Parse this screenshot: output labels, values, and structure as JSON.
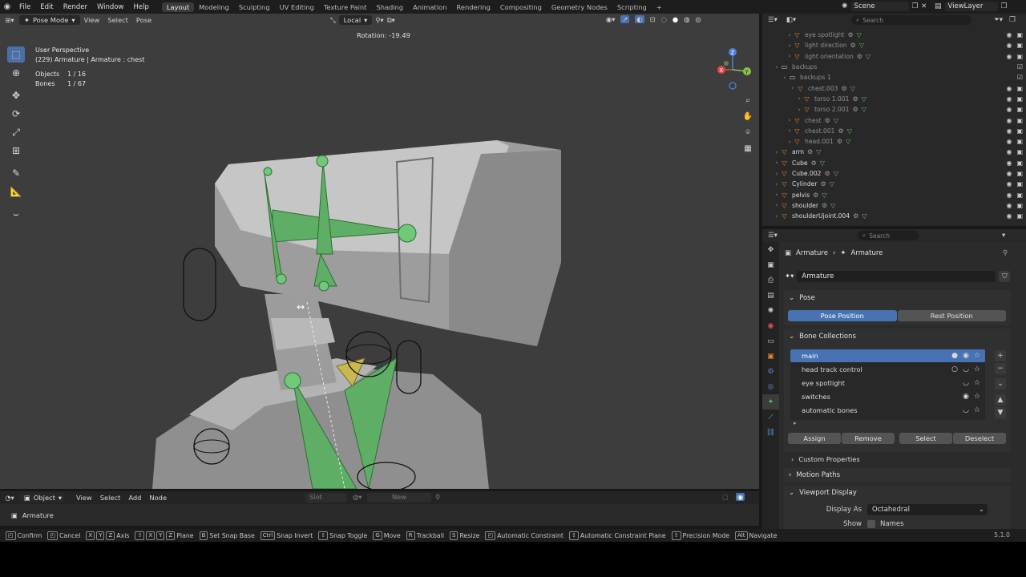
{
  "topbar": {
    "menus": [
      "File",
      "Edit",
      "Render",
      "Window",
      "Help"
    ],
    "workspaces": [
      "Layout",
      "Modeling",
      "Sculpting",
      "UV Editing",
      "Texture Paint",
      "Shading",
      "Animation",
      "Rendering",
      "Compositing",
      "Geometry Nodes",
      "Scripting"
    ],
    "active_workspace": "Layout",
    "plus_label": "+",
    "scene": "Scene",
    "view_layer": "ViewLayer"
  },
  "viewport": {
    "mode": "Pose Mode",
    "menus": [
      "View",
      "Select",
      "Pose"
    ],
    "orientation": "Local",
    "operator_readout": "Rotation: -19.49",
    "overlay": {
      "perspective": "User Perspective",
      "active": "(229) Armature | Armature : chest",
      "objects_label": "Objects",
      "objects_value": "1 / 16",
      "bones_label": "Bones",
      "bones_value": "1 / 67"
    },
    "gizmo": {
      "x": "X",
      "y": "Y",
      "z": "Z"
    }
  },
  "outliner": {
    "search_placeholder": "Search",
    "rows": [
      {
        "label": "eye spotlight",
        "dim": true
      },
      {
        "label": "light direction",
        "dim": true
      },
      {
        "label": "light orientation",
        "dim": true
      },
      {
        "label": "backups",
        "dim": true
      },
      {
        "label": "backups 1",
        "dim": true
      },
      {
        "label": "chest.003",
        "dim": true
      },
      {
        "label": "torso 1.001",
        "dim": true
      },
      {
        "label": "torso 2.001",
        "dim": true
      },
      {
        "label": "chest",
        "dim": true
      },
      {
        "label": "chest.001",
        "dim": true
      },
      {
        "label": "head.001",
        "dim": true
      },
      {
        "label": "arm",
        "dim": false
      },
      {
        "label": "Cube",
        "dim": false
      },
      {
        "label": "Cube.002",
        "dim": false
      },
      {
        "label": "Cylinder",
        "dim": false
      },
      {
        "label": "pelvis",
        "dim": false
      },
      {
        "label": "shoulder",
        "dim": false
      },
      {
        "label": "shoulderUjoint.004",
        "dim": false
      }
    ]
  },
  "properties": {
    "search_placeholder": "Search",
    "breadcrumb": [
      "Armature",
      "Armature"
    ],
    "datablock": "Armature",
    "pose": {
      "title": "Pose",
      "pose_position": "Pose Position",
      "rest_position": "Rest Position"
    },
    "bone_collections": {
      "title": "Bone Collections",
      "items": [
        "main",
        "head track control",
        "eye spotlight",
        "switches",
        "automatic bones"
      ],
      "assign": "Assign",
      "remove": "Remove",
      "select": "Select",
      "deselect": "Deselect"
    },
    "custom_properties": "Custom Properties",
    "motion_paths": "Motion Paths",
    "viewport_display": {
      "title": "Viewport Display",
      "display_as_label": "Display As",
      "display_as_value": "Octahedral",
      "show_label": "Show",
      "names_label": "Names"
    }
  },
  "bottom": {
    "editor_mode": "Object",
    "menus": [
      "View",
      "Select",
      "Add",
      "Node"
    ],
    "slot": "Slot",
    "new": "New",
    "active_object": "Armature"
  },
  "statusbar": {
    "items": [
      {
        "key": "",
        "label": "Confirm"
      },
      {
        "key": "",
        "label": "Cancel"
      },
      {
        "key": "X Y Z",
        "label": "Axis"
      },
      {
        "key": "⇧ X Y Z",
        "label": "Plane"
      },
      {
        "key": "B",
        "label": "Set Snap Base"
      },
      {
        "key": "Ctrl",
        "label": "Snap Invert"
      },
      {
        "key": "⇧",
        "label": "Snap Toggle"
      },
      {
        "key": "G",
        "label": "Move"
      },
      {
        "key": "R",
        "label": "Trackball"
      },
      {
        "key": "S",
        "label": "Resize"
      },
      {
        "key": "",
        "label": "Automatic Constraint"
      },
      {
        "key": "⇧",
        "label": "Automatic Constraint Plane"
      },
      {
        "key": "⇧",
        "label": "Precision Mode"
      },
      {
        "key": "Alt",
        "label": "Navigate"
      }
    ],
    "version": "5.1.0"
  },
  "colors": {
    "accent": "#4772b3",
    "bone_green": "#5fae66",
    "object_orange": "#e5842b"
  }
}
